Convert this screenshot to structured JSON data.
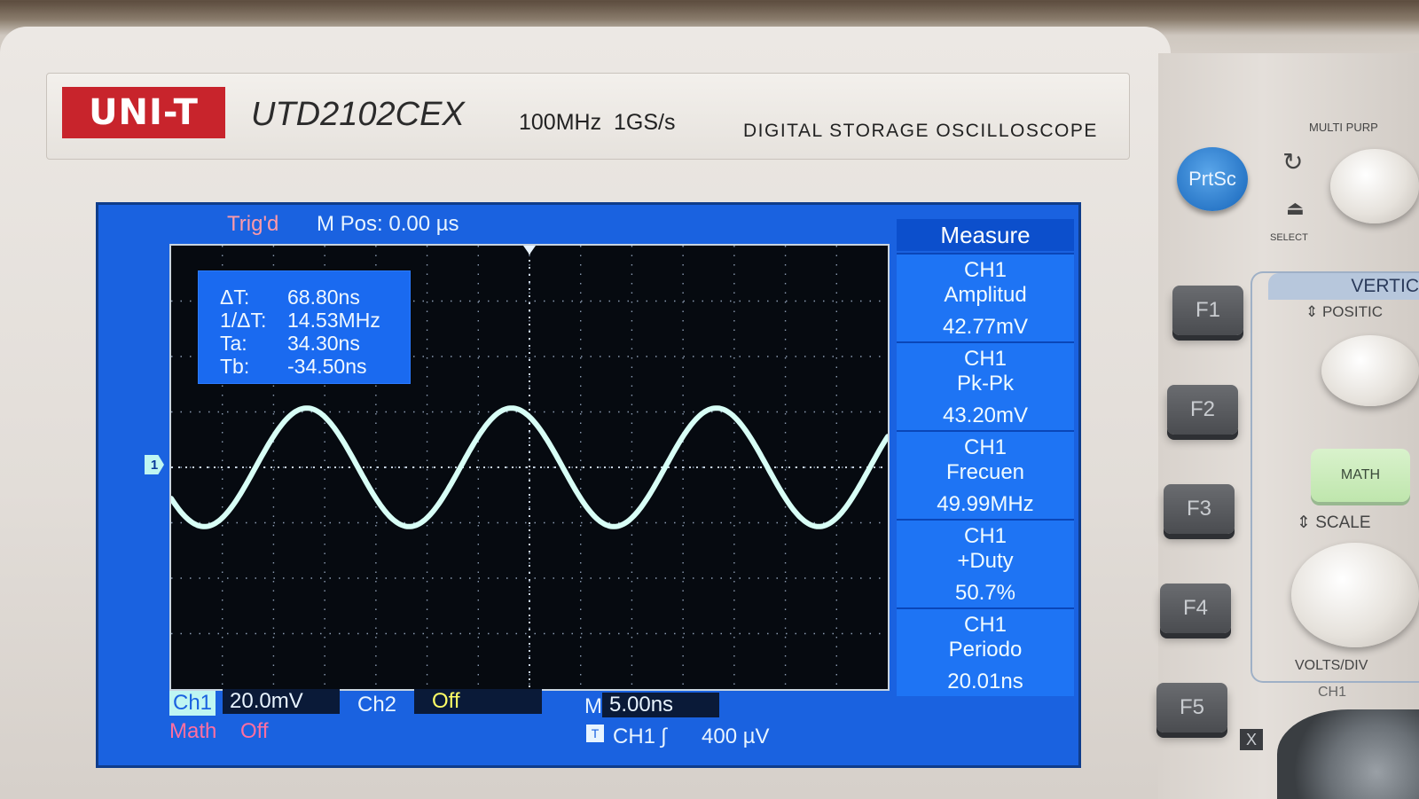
{
  "device": {
    "brand": "UNI-T",
    "model": "UTD2102CEX",
    "specs": "100MHz  1GS/s",
    "description": "DIGITAL STORAGE OSCILLOSCOPE"
  },
  "screen": {
    "trig_status": "Trig'd",
    "m_pos": "M Pos: 0.00 µs",
    "cursor_readout": {
      "delta_t_label": "ΔT:",
      "delta_t_value": "68.80ns",
      "inv_delta_t_label": "1/ΔT:",
      "inv_delta_t_value": "14.53MHz",
      "ta_label": "Ta:",
      "ta_value": "34.30ns",
      "tb_label": "Tb:",
      "tb_value": "-34.50ns"
    },
    "channel_marker": "1",
    "measure": {
      "title": "Measure",
      "items": [
        {
          "ch": "CH1",
          "name": "Amplitud",
          "value": "42.77mV"
        },
        {
          "ch": "CH1",
          "name": "Pk-Pk",
          "value": "43.20mV"
        },
        {
          "ch": "CH1",
          "name": "Frecuen",
          "value": "49.99MHz"
        },
        {
          "ch": "CH1",
          "name": "+Duty",
          "value": "50.7%"
        },
        {
          "ch": "CH1",
          "name": "Periodo",
          "value": "20.01ns"
        }
      ]
    },
    "bottom": {
      "ch1_label": "Ch1",
      "ch1_scale": "20.0mV",
      "ch2_label": "Ch2",
      "ch2_value": "Off",
      "m_label": "M",
      "timebase": "5.00ns",
      "math_label": "Math",
      "math_value": "Off",
      "trigger_icon": "T",
      "trigger_source": "CH1",
      "trigger_edge": "∫",
      "trigger_level": "400 µV"
    },
    "colors": {
      "screen_bg": "#1a62e0",
      "trace": "#d8fff6",
      "grid_bg": "#060a10"
    }
  },
  "controls": {
    "prtsc": "PrtSc",
    "function_keys": [
      "F1",
      "F2",
      "F3",
      "F4",
      "F5"
    ],
    "multi_purpose": "MULTI PURP",
    "select": "SELECT",
    "vertical": "VERTIC",
    "position": "POSITIC",
    "math_button": "MATH",
    "scale": "SCALE",
    "volts_div": "VOLTS/DIV",
    "ch1_input": "CH1",
    "x_button": "X"
  },
  "waveform": {
    "type": "sine",
    "frequency_mhz": 49.99,
    "amplitude_mv": 42.77,
    "timebase_ns_per_div": 5.0,
    "volts_per_div_mv": 20.0
  }
}
